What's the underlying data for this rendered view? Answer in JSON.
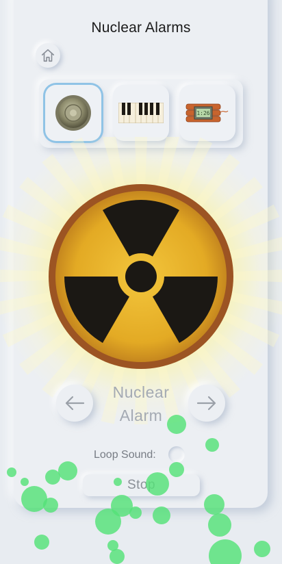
{
  "header": {
    "title": "Nuclear Alarms"
  },
  "sounds": [
    {
      "name": "speaker-icon",
      "selected": true
    },
    {
      "name": "piano-icon",
      "selected": false
    },
    {
      "name": "time-bomb-icon",
      "selected": false
    }
  ],
  "main": {
    "image": "radiation-symbol-icon",
    "sound_name_line1": "Nuclear",
    "sound_name_line2": "Alarm",
    "prev_icon": "arrow-left-icon",
    "next_icon": "arrow-right-icon"
  },
  "controls": {
    "loop_label": "Loop Sound:",
    "loop_enabled": false,
    "stop_label": "Stop"
  },
  "colors": {
    "background": "#eceff3",
    "bubble": "#5ee882",
    "selected_outline": "#8fc3e6",
    "radiation_yellow": "#e8b429",
    "radiation_border": "#a05a22"
  }
}
